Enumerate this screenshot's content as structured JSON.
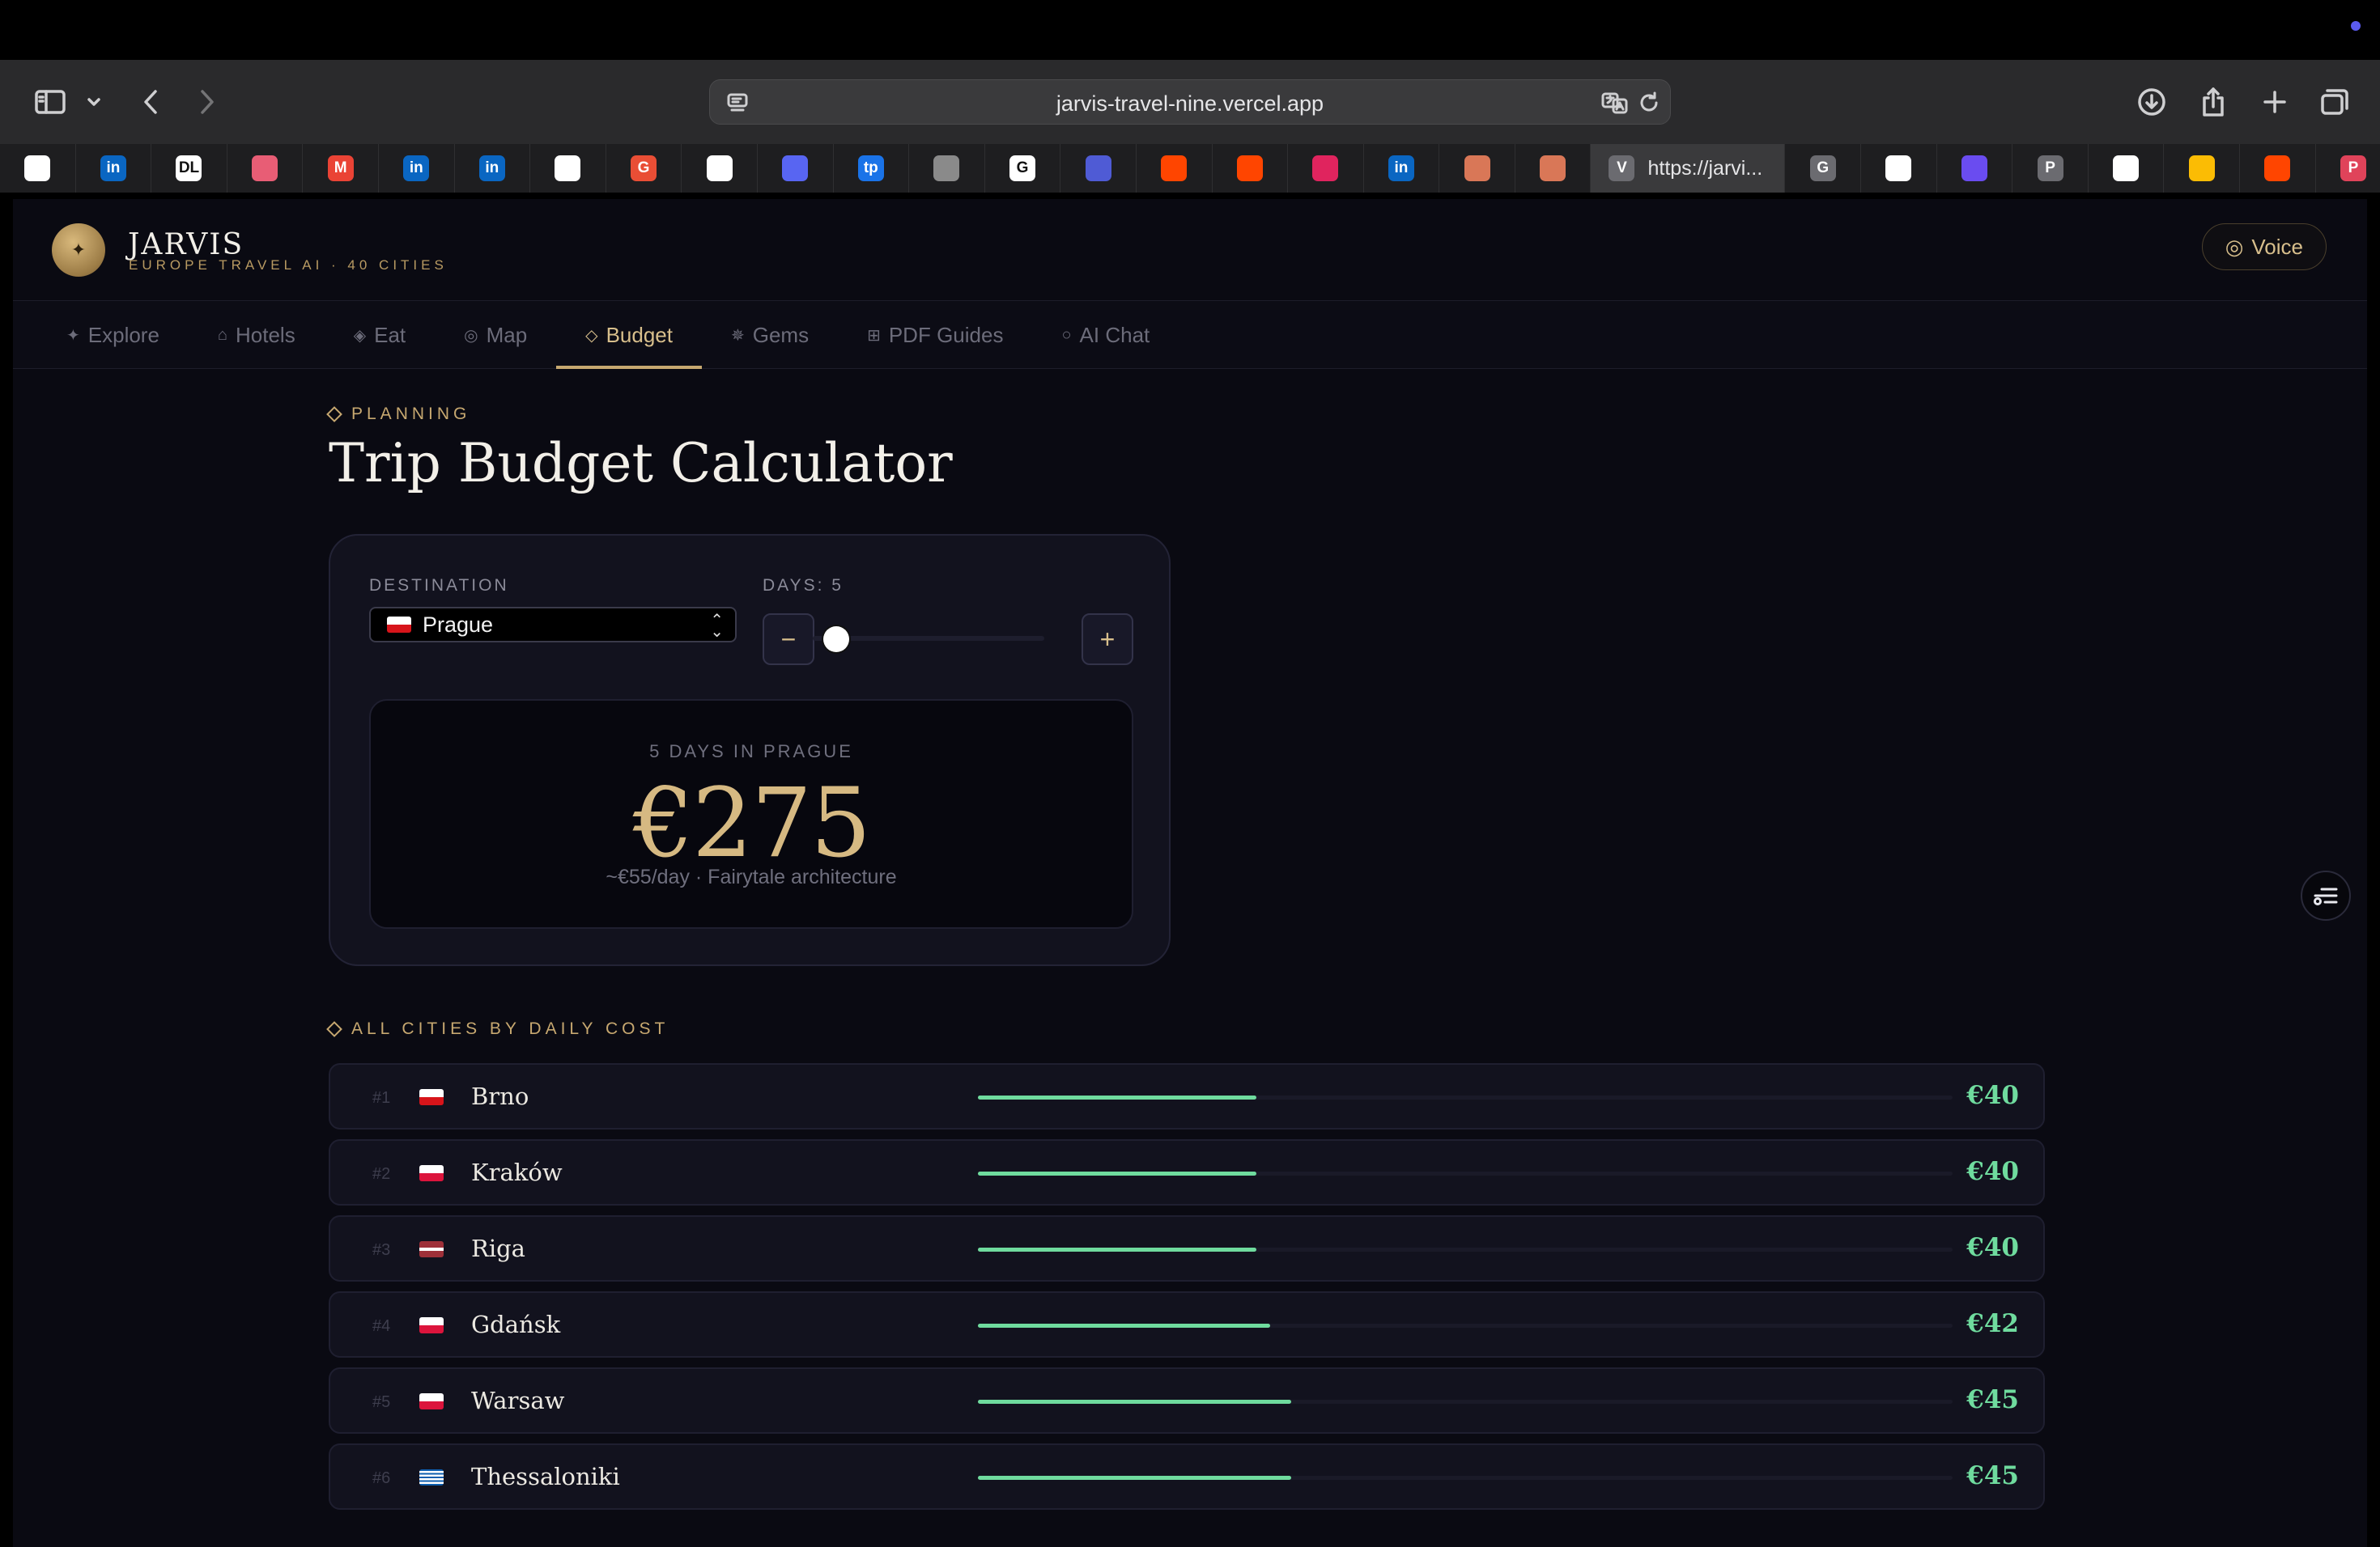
{
  "browser": {
    "url": "jarvis-travel-nine.vercel.app",
    "active_tab_title": "https://jarvi...",
    "active_tab_favicon_letter": "V",
    "bookmarks": [
      {
        "icon": "openai-icon",
        "letter": "",
        "color": "#ffffff"
      },
      {
        "icon": "linkedin-icon",
        "letter": "in",
        "color": "#0a66c2"
      },
      {
        "icon": "dl-icon",
        "letter": "DL",
        "color": "#ffffff"
      },
      {
        "icon": "ticket-icon",
        "letter": "",
        "color": "#e85d75"
      },
      {
        "icon": "gmail-icon",
        "letter": "M",
        "color": "#ea4335"
      },
      {
        "icon": "linkedin-icon",
        "letter": "in",
        "color": "#0a66c2"
      },
      {
        "icon": "linkedin-icon",
        "letter": "in",
        "color": "#0a66c2"
      },
      {
        "icon": "openai-icon",
        "letter": "",
        "color": "#ffffff"
      },
      {
        "icon": "g-red-icon",
        "letter": "G",
        "color": "#e94e35"
      },
      {
        "icon": "lufthansa-icon",
        "letter": "",
        "color": "#ffffff"
      },
      {
        "icon": "discord-icon",
        "letter": "",
        "color": "#5865f2"
      },
      {
        "icon": "tp-icon",
        "letter": "tp",
        "color": "#1a73e8"
      },
      {
        "icon": "cube-icon",
        "letter": "",
        "color": "#8a8a8a"
      },
      {
        "icon": "google-icon",
        "letter": "G",
        "color": "#ffffff"
      },
      {
        "icon": "chat-bubble-icon",
        "letter": "",
        "color": "#4f5bd5"
      },
      {
        "icon": "reddit-icon",
        "letter": "",
        "color": "#ff4500"
      },
      {
        "icon": "reddit-icon",
        "letter": "",
        "color": "#ff4500"
      },
      {
        "icon": "heart-icon",
        "letter": "",
        "color": "#e0245e"
      },
      {
        "icon": "linkedin-icon",
        "letter": "in",
        "color": "#0a66c2"
      },
      {
        "icon": "claude-icon",
        "letter": "",
        "color": "#d97757"
      },
      {
        "icon": "claude-dark-icon",
        "letter": "",
        "color": "#d97757"
      },
      {
        "icon": "g-gray-icon",
        "letter": "G",
        "color": "#6b6b70"
      },
      {
        "icon": "github-icon",
        "letter": "",
        "color": "#ffffff"
      },
      {
        "icon": "purple-doc-icon",
        "letter": "",
        "color": "#6a4cf0"
      },
      {
        "icon": "p-gray-icon",
        "letter": "P",
        "color": "#6b6b70"
      },
      {
        "icon": "vercel-icon",
        "letter": "",
        "color": "#ffffff"
      },
      {
        "icon": "ads-icon",
        "letter": "",
        "color": "#fbbc04"
      },
      {
        "icon": "reddit-icon",
        "letter": "",
        "color": "#ff4500"
      },
      {
        "icon": "p-red-icon",
        "letter": "P",
        "color": "#e0435a"
      }
    ]
  },
  "header": {
    "brand": "JARVIS",
    "subtitle": "EUROPE TRAVEL AI · 40 CITIES",
    "voice_label": "Voice"
  },
  "nav": [
    {
      "glyph": "✦",
      "label": "Explore",
      "active": false
    },
    {
      "glyph": "⌂",
      "label": "Hotels",
      "active": false
    },
    {
      "glyph": "◈",
      "label": "Eat",
      "active": false
    },
    {
      "glyph": "◎",
      "label": "Map",
      "active": false
    },
    {
      "glyph": "◇",
      "label": "Budget",
      "active": true
    },
    {
      "glyph": "✵",
      "label": "Gems",
      "active": false
    },
    {
      "glyph": "⊞",
      "label": "PDF Guides",
      "active": false
    },
    {
      "glyph": "○",
      "label": "AI Chat",
      "active": false
    }
  ],
  "planner": {
    "eyebrow": "PLANNING",
    "title": "Trip Budget Calculator",
    "destination_label": "DESTINATION",
    "destination_value": "Prague",
    "days_label": "DAYS: 5",
    "days_value": 5,
    "days_fraction": 0.1,
    "minus": "−",
    "plus": "+",
    "result_label": "5 DAYS IN PRAGUE",
    "result_amount": "€275",
    "result_note": "~€55/day · Fairytale architecture"
  },
  "cities_section": {
    "eyebrow": "ALL CITIES BY DAILY COST",
    "max_scale": 140,
    "rows": [
      {
        "rank": "#1",
        "name": "Brno",
        "flag": "cz",
        "daily": 40,
        "cost": "€40"
      },
      {
        "rank": "#2",
        "name": "Kraków",
        "flag": "pl",
        "daily": 40,
        "cost": "€40"
      },
      {
        "rank": "#3",
        "name": "Riga",
        "flag": "lv",
        "daily": 40,
        "cost": "€40"
      },
      {
        "rank": "#4",
        "name": "Gdańsk",
        "flag": "pl",
        "daily": 42,
        "cost": "€42"
      },
      {
        "rank": "#5",
        "name": "Warsaw",
        "flag": "pl",
        "daily": 45,
        "cost": "€45"
      },
      {
        "rank": "#6",
        "name": "Thessaloniki",
        "flag": "gr",
        "daily": 45,
        "cost": "€45"
      }
    ]
  },
  "colors": {
    "accent_gold": "#c7a870",
    "cost_green": "#6fdb9e",
    "background": "#0a0a12"
  }
}
